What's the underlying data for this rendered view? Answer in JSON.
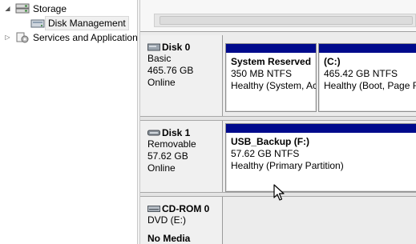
{
  "tree": {
    "storage_label": "Storage",
    "disk_management_label": "Disk Management",
    "services_label": "Services and Applications"
  },
  "disks": [
    {
      "title": "Disk 0",
      "type": "Basic",
      "size": "465.76 GB",
      "status": "Online",
      "partitions": [
        {
          "name": "System Reserved",
          "size_fs": "350 MB NTFS",
          "health": "Healthy (System, Active, Primary Partition)"
        },
        {
          "name": "(C:)",
          "size_fs": "465.42 GB NTFS",
          "health": "Healthy (Boot, Page File, Crash Dump, Primary Partition)"
        }
      ]
    },
    {
      "title": "Disk 1",
      "type": "Removable",
      "size": "57.62 GB",
      "status": "Online",
      "partitions": [
        {
          "name": "USB_Backup  (F:)",
          "size_fs": "57.62 GB NTFS",
          "health": "Healthy (Primary Partition)"
        }
      ]
    },
    {
      "title": "CD-ROM 0",
      "type": "DVD (E:)",
      "status": "No Media"
    }
  ],
  "colors": {
    "primary_partition_bar": "#000a8c",
    "pane_background": "#ececec"
  }
}
